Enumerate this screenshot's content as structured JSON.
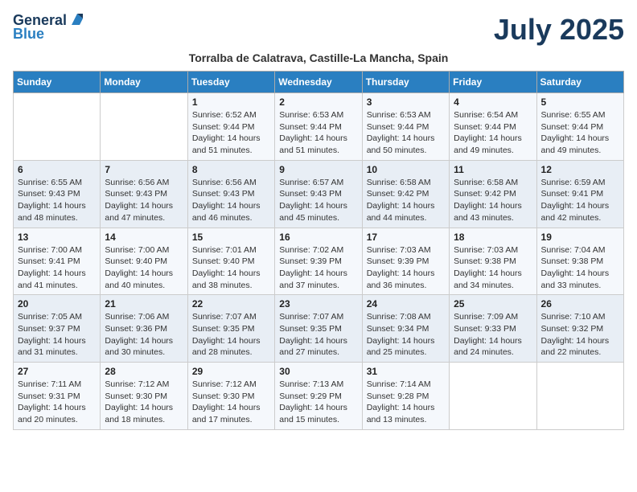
{
  "header": {
    "logo_line1": "General",
    "logo_line2": "Blue",
    "month": "July 2025",
    "subtitle": "Torralba de Calatrava, Castille-La Mancha, Spain"
  },
  "weekdays": [
    "Sunday",
    "Monday",
    "Tuesday",
    "Wednesday",
    "Thursday",
    "Friday",
    "Saturday"
  ],
  "weeks": [
    [
      {
        "day": "",
        "sunrise": "",
        "sunset": "",
        "daylight": ""
      },
      {
        "day": "",
        "sunrise": "",
        "sunset": "",
        "daylight": ""
      },
      {
        "day": "1",
        "sunrise": "Sunrise: 6:52 AM",
        "sunset": "Sunset: 9:44 PM",
        "daylight": "Daylight: 14 hours and 51 minutes."
      },
      {
        "day": "2",
        "sunrise": "Sunrise: 6:53 AM",
        "sunset": "Sunset: 9:44 PM",
        "daylight": "Daylight: 14 hours and 51 minutes."
      },
      {
        "day": "3",
        "sunrise": "Sunrise: 6:53 AM",
        "sunset": "Sunset: 9:44 PM",
        "daylight": "Daylight: 14 hours and 50 minutes."
      },
      {
        "day": "4",
        "sunrise": "Sunrise: 6:54 AM",
        "sunset": "Sunset: 9:44 PM",
        "daylight": "Daylight: 14 hours and 49 minutes."
      },
      {
        "day": "5",
        "sunrise": "Sunrise: 6:55 AM",
        "sunset": "Sunset: 9:44 PM",
        "daylight": "Daylight: 14 hours and 49 minutes."
      }
    ],
    [
      {
        "day": "6",
        "sunrise": "Sunrise: 6:55 AM",
        "sunset": "Sunset: 9:43 PM",
        "daylight": "Daylight: 14 hours and 48 minutes."
      },
      {
        "day": "7",
        "sunrise": "Sunrise: 6:56 AM",
        "sunset": "Sunset: 9:43 PM",
        "daylight": "Daylight: 14 hours and 47 minutes."
      },
      {
        "day": "8",
        "sunrise": "Sunrise: 6:56 AM",
        "sunset": "Sunset: 9:43 PM",
        "daylight": "Daylight: 14 hours and 46 minutes."
      },
      {
        "day": "9",
        "sunrise": "Sunrise: 6:57 AM",
        "sunset": "Sunset: 9:43 PM",
        "daylight": "Daylight: 14 hours and 45 minutes."
      },
      {
        "day": "10",
        "sunrise": "Sunrise: 6:58 AM",
        "sunset": "Sunset: 9:42 PM",
        "daylight": "Daylight: 14 hours and 44 minutes."
      },
      {
        "day": "11",
        "sunrise": "Sunrise: 6:58 AM",
        "sunset": "Sunset: 9:42 PM",
        "daylight": "Daylight: 14 hours and 43 minutes."
      },
      {
        "day": "12",
        "sunrise": "Sunrise: 6:59 AM",
        "sunset": "Sunset: 9:41 PM",
        "daylight": "Daylight: 14 hours and 42 minutes."
      }
    ],
    [
      {
        "day": "13",
        "sunrise": "Sunrise: 7:00 AM",
        "sunset": "Sunset: 9:41 PM",
        "daylight": "Daylight: 14 hours and 41 minutes."
      },
      {
        "day": "14",
        "sunrise": "Sunrise: 7:00 AM",
        "sunset": "Sunset: 9:40 PM",
        "daylight": "Daylight: 14 hours and 40 minutes."
      },
      {
        "day": "15",
        "sunrise": "Sunrise: 7:01 AM",
        "sunset": "Sunset: 9:40 PM",
        "daylight": "Daylight: 14 hours and 38 minutes."
      },
      {
        "day": "16",
        "sunrise": "Sunrise: 7:02 AM",
        "sunset": "Sunset: 9:39 PM",
        "daylight": "Daylight: 14 hours and 37 minutes."
      },
      {
        "day": "17",
        "sunrise": "Sunrise: 7:03 AM",
        "sunset": "Sunset: 9:39 PM",
        "daylight": "Daylight: 14 hours and 36 minutes."
      },
      {
        "day": "18",
        "sunrise": "Sunrise: 7:03 AM",
        "sunset": "Sunset: 9:38 PM",
        "daylight": "Daylight: 14 hours and 34 minutes."
      },
      {
        "day": "19",
        "sunrise": "Sunrise: 7:04 AM",
        "sunset": "Sunset: 9:38 PM",
        "daylight": "Daylight: 14 hours and 33 minutes."
      }
    ],
    [
      {
        "day": "20",
        "sunrise": "Sunrise: 7:05 AM",
        "sunset": "Sunset: 9:37 PM",
        "daylight": "Daylight: 14 hours and 31 minutes."
      },
      {
        "day": "21",
        "sunrise": "Sunrise: 7:06 AM",
        "sunset": "Sunset: 9:36 PM",
        "daylight": "Daylight: 14 hours and 30 minutes."
      },
      {
        "day": "22",
        "sunrise": "Sunrise: 7:07 AM",
        "sunset": "Sunset: 9:35 PM",
        "daylight": "Daylight: 14 hours and 28 minutes."
      },
      {
        "day": "23",
        "sunrise": "Sunrise: 7:07 AM",
        "sunset": "Sunset: 9:35 PM",
        "daylight": "Daylight: 14 hours and 27 minutes."
      },
      {
        "day": "24",
        "sunrise": "Sunrise: 7:08 AM",
        "sunset": "Sunset: 9:34 PM",
        "daylight": "Daylight: 14 hours and 25 minutes."
      },
      {
        "day": "25",
        "sunrise": "Sunrise: 7:09 AM",
        "sunset": "Sunset: 9:33 PM",
        "daylight": "Daylight: 14 hours and 24 minutes."
      },
      {
        "day": "26",
        "sunrise": "Sunrise: 7:10 AM",
        "sunset": "Sunset: 9:32 PM",
        "daylight": "Daylight: 14 hours and 22 minutes."
      }
    ],
    [
      {
        "day": "27",
        "sunrise": "Sunrise: 7:11 AM",
        "sunset": "Sunset: 9:31 PM",
        "daylight": "Daylight: 14 hours and 20 minutes."
      },
      {
        "day": "28",
        "sunrise": "Sunrise: 7:12 AM",
        "sunset": "Sunset: 9:30 PM",
        "daylight": "Daylight: 14 hours and 18 minutes."
      },
      {
        "day": "29",
        "sunrise": "Sunrise: 7:12 AM",
        "sunset": "Sunset: 9:30 PM",
        "daylight": "Daylight: 14 hours and 17 minutes."
      },
      {
        "day": "30",
        "sunrise": "Sunrise: 7:13 AM",
        "sunset": "Sunset: 9:29 PM",
        "daylight": "Daylight: 14 hours and 15 minutes."
      },
      {
        "day": "31",
        "sunrise": "Sunrise: 7:14 AM",
        "sunset": "Sunset: 9:28 PM",
        "daylight": "Daylight: 14 hours and 13 minutes."
      },
      {
        "day": "",
        "sunrise": "",
        "sunset": "",
        "daylight": ""
      },
      {
        "day": "",
        "sunrise": "",
        "sunset": "",
        "daylight": ""
      }
    ]
  ]
}
